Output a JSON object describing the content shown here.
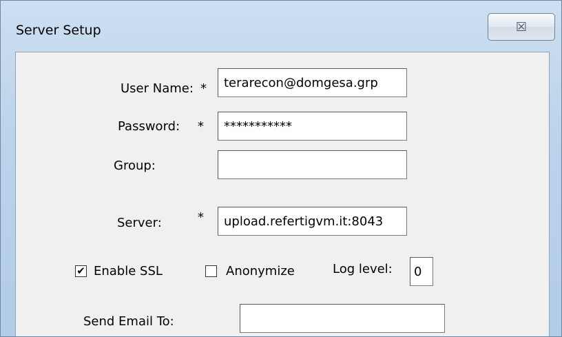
{
  "window": {
    "title": "Server Setup",
    "close_glyph": "☒"
  },
  "form": {
    "username": {
      "label": "User Name:",
      "required": "*",
      "value": "terarecon@domgesa.grp"
    },
    "password": {
      "label": "Password:",
      "required": "*",
      "value": "***********"
    },
    "group": {
      "label": "Group:",
      "value": ""
    },
    "server": {
      "label": "Server:",
      "required": "*",
      "value": "upload.refertigvm.it:8043"
    },
    "enable_ssl": {
      "label": "Enable SSL",
      "checked": true,
      "mark": "✔"
    },
    "anonymize": {
      "label": "Anonymize",
      "checked": false,
      "mark": ""
    },
    "log_level": {
      "label": "Log level:",
      "value": "0"
    },
    "send_email": {
      "label": "Send Email To:",
      "value": ""
    }
  }
}
